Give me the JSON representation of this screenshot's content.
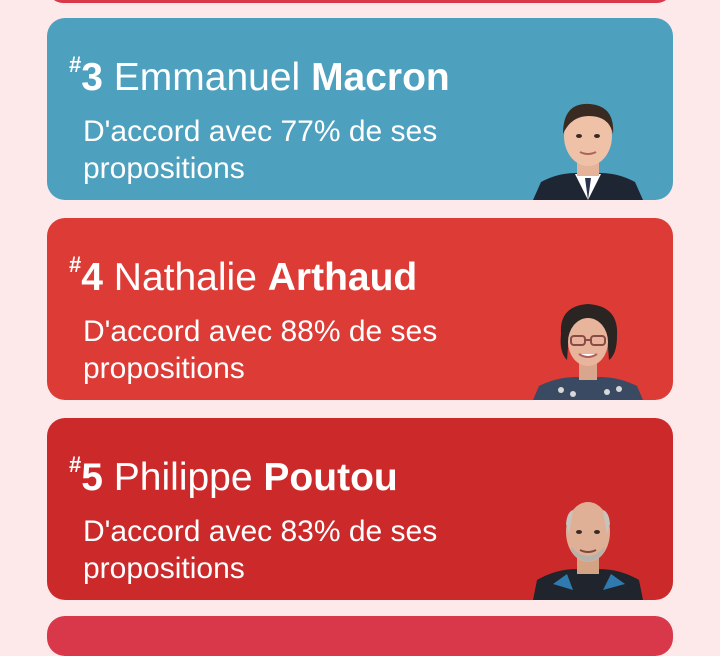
{
  "candidates": [
    {
      "rank_prefix": "#",
      "rank": "3",
      "first_name": "Emmanuel",
      "last_name": "Macron",
      "agreement": "D'accord avec 77% de ses propositions",
      "agreement_percent": 77,
      "color": "#4ea0bf"
    },
    {
      "rank_prefix": "#",
      "rank": "4",
      "first_name": "Nathalie",
      "last_name": "Arthaud",
      "agreement": "D'accord avec 88% de ses propositions",
      "agreement_percent": 88,
      "color": "#dd3b36"
    },
    {
      "rank_prefix": "#",
      "rank": "5",
      "first_name": "Philippe",
      "last_name": "Poutou",
      "agreement": "D'accord avec 83% de ses propositions",
      "agreement_percent": 83,
      "color": "#cc2a2a"
    }
  ],
  "colors": {
    "background": "#fde8ea",
    "neighbor_card": "#d9374a"
  },
  "icons": [
    "portrait-macron",
    "portrait-arthaud",
    "portrait-poutou"
  ]
}
